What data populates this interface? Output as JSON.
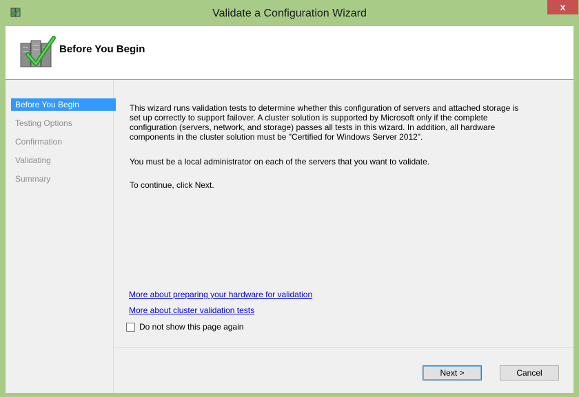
{
  "window": {
    "title": "Validate a Configuration Wizard",
    "close_label": "x"
  },
  "header": {
    "title": "Before You Begin"
  },
  "sidebar": {
    "steps": [
      {
        "label": "Before You Begin",
        "active": true
      },
      {
        "label": "Testing Options",
        "active": false
      },
      {
        "label": "Confirmation",
        "active": false
      },
      {
        "label": "Validating",
        "active": false
      },
      {
        "label": "Summary",
        "active": false
      }
    ]
  },
  "main": {
    "intro_lines": [
      "This wizard runs validation tests to determine whether this configuration of servers and attached storage is",
      "set up correctly to support failover. A cluster solution is supported by Microsoft only if the complete",
      "configuration (servers, network, and storage) passes all tests in this wizard. In addition, all hardware",
      "components in the cluster solution must be \"Certified for Windows Server 2012\"."
    ],
    "admin_note": "You must be a local administrator on each of the servers that you want to validate.",
    "continue_note": "To continue, click Next.",
    "link_hardware": "More about preparing your hardware for validation",
    "link_tests": "More about cluster validation tests",
    "checkbox_label": "Do not show this page again",
    "checkbox_checked": false
  },
  "buttons": {
    "next": "Next >",
    "cancel": "Cancel"
  },
  "colors": {
    "titlebar": "#a8cc88",
    "close": "#c75050",
    "selection": "#3399ff",
    "link": "#0000ee"
  }
}
